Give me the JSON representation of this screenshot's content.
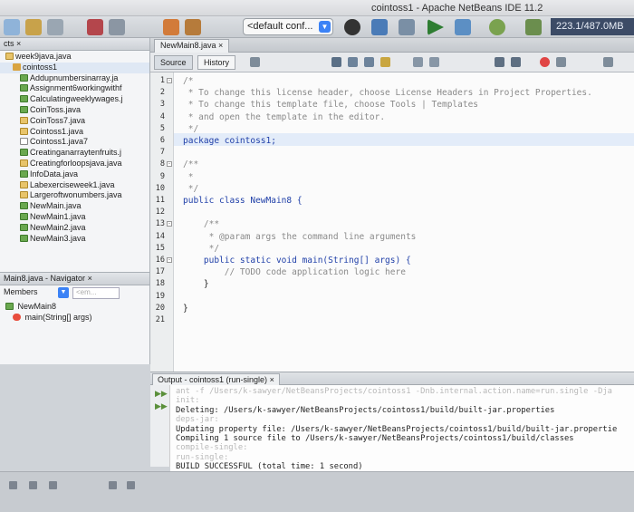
{
  "window": {
    "title": "cointoss1 - Apache NetBeans IDE 11.2"
  },
  "toolbar": {
    "config_value": "<default conf...",
    "memory": "223.1/487.0MB"
  },
  "projects_panel": {
    "tab": "cts",
    "items": [
      {
        "label": "week9java.java",
        "icon": "java-file-icon"
      },
      {
        "label": "cointoss1",
        "icon": "package-icon"
      },
      {
        "label": "Addupnumbersinarray.ja",
        "icon": "main-class-icon"
      },
      {
        "label": "Assignment6workingwithf",
        "icon": "main-class-icon"
      },
      {
        "label": "Calculatingweeklywages.j",
        "icon": "main-class-icon"
      },
      {
        "label": "CoinToss.java",
        "icon": "main-class-icon"
      },
      {
        "label": "CoinToss7.java",
        "icon": "java-file-icon"
      },
      {
        "label": "Cointoss1.java",
        "icon": "java-file-icon"
      },
      {
        "label": "Cointoss1.java7",
        "icon": "plain-file-icon"
      },
      {
        "label": "Creatinganarraytenfruits.j",
        "icon": "main-class-icon"
      },
      {
        "label": "Creatingforloopsjava.java",
        "icon": "java-file-icon"
      },
      {
        "label": "InfoData.java",
        "icon": "main-class-icon"
      },
      {
        "label": "Labexerciseweek1.java",
        "icon": "java-file-icon"
      },
      {
        "label": "Largeroftwonumbers.java",
        "icon": "java-file-icon"
      },
      {
        "label": "NewMain.java",
        "icon": "main-class-icon"
      },
      {
        "label": "NewMain1.java",
        "icon": "main-class-icon"
      },
      {
        "label": "NewMain2.java",
        "icon": "main-class-icon"
      },
      {
        "label": "NewMain3.java",
        "icon": "main-class-icon"
      }
    ]
  },
  "navigator": {
    "tab": "Main8.java - Navigator",
    "close": "×",
    "members_label": "Members",
    "filter_placeholder": "<em...",
    "class_name": "NewMain8",
    "method": "main(String[] args)"
  },
  "editor": {
    "tab": "NewMain8.java",
    "close": "×",
    "source_btn": "Source",
    "history_btn": "History",
    "lines": [
      {
        "n": "1",
        "text": "/*",
        "cls": "c-com"
      },
      {
        "n": "2",
        "text": " * To change this license header, choose License Headers in Project Properties.",
        "cls": "c-com"
      },
      {
        "n": "3",
        "text": " * To change this template file, choose Tools | Templates",
        "cls": "c-com"
      },
      {
        "n": "4",
        "text": " * and open the template in the editor.",
        "cls": "c-com"
      },
      {
        "n": "5",
        "text": " */",
        "cls": "c-com"
      },
      {
        "n": "6",
        "text": "package cointoss1;",
        "cls": "c-kw"
      },
      {
        "n": "7",
        "text": "",
        "cls": ""
      },
      {
        "n": "8",
        "text": "/**",
        "cls": "c-com"
      },
      {
        "n": "9",
        "text": " *",
        "cls": "c-com"
      },
      {
        "n": "10",
        "text": " */",
        "cls": "c-com"
      },
      {
        "n": "11",
        "text": "public class NewMain8 {",
        "cls": "c-kw"
      },
      {
        "n": "12",
        "text": "",
        "cls": ""
      },
      {
        "n": "13",
        "text": "    /**",
        "cls": "c-com"
      },
      {
        "n": "14",
        "text": "     * @param args the command line arguments",
        "cls": "c-com"
      },
      {
        "n": "15",
        "text": "     */",
        "cls": "c-com"
      },
      {
        "n": "16",
        "text": "    public static void main(String[] args) {",
        "cls": "c-kw"
      },
      {
        "n": "17",
        "text": "        // TODO code application logic here",
        "cls": "c-com"
      },
      {
        "n": "18",
        "text": "    }",
        "cls": ""
      },
      {
        "n": "19",
        "text": "",
        "cls": ""
      },
      {
        "n": "20",
        "text": "}",
        "cls": ""
      },
      {
        "n": "21",
        "text": "",
        "cls": ""
      }
    ]
  },
  "output": {
    "tab": "Output - cointoss1 (run-single)",
    "close": "×",
    "lines": [
      {
        "text": "ant -f /Users/k-sawyer/NetBeansProjects/cointoss1 -Dnb.internal.action.name=run.single -Dja",
        "cls": "o-faint"
      },
      {
        "text": "init:",
        "cls": "o-faint"
      },
      {
        "text": "Deleting: /Users/k-sawyer/NetBeansProjects/cointoss1/build/built-jar.properties",
        "cls": "o-norm"
      },
      {
        "text": "deps-jar:",
        "cls": "o-faint"
      },
      {
        "text": "Updating property file: /Users/k-sawyer/NetBeansProjects/cointoss1/build/built-jar.propertie",
        "cls": "o-norm"
      },
      {
        "text": "Compiling 1 source file to /Users/k-sawyer/NetBeansProjects/cointoss1/build/classes",
        "cls": "o-norm"
      },
      {
        "text": "compile-single:",
        "cls": "o-faint"
      },
      {
        "text": "run-single:",
        "cls": "o-faint"
      },
      {
        "text": "BUILD SUCCESSFUL (total time: 1 second)",
        "cls": "o-norm"
      }
    ]
  },
  "colors": {
    "memory_bg": "#3c4b66",
    "accent": "#3b82f6"
  }
}
